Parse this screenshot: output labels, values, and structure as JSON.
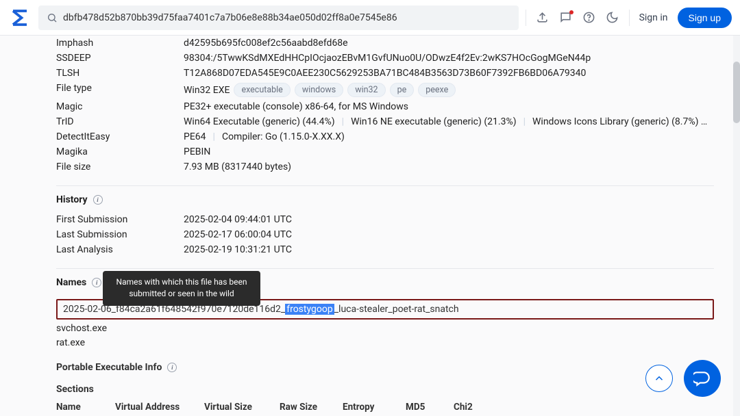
{
  "header": {
    "search_value": "dbfb478d52b870bb39d75faa7401c7a7b06e8e88b34ae050d02ff8a0e7545e86",
    "signin": "Sign in",
    "signup": "Sign up"
  },
  "details": {
    "imphash": {
      "label": "Imphash",
      "value": "d42595b695fc008ef2c56aabd8efd68e"
    },
    "ssdeep": {
      "label": "SSDEEP",
      "value": "98304:/5TwwKSdMXEdHHCpIOcjaozEBvM1GvfUNuo0U/ODwzE4f2Ev:2wKS7HOcGogMGeN44p"
    },
    "tlsh": {
      "label": "TLSH",
      "value": "T12A868D07EDA545E9C0AEE230C5629253BA71BC484B3563D73B60F7392FB6BD06A79340"
    },
    "filetype": {
      "label": "File type",
      "value": "Win32 EXE",
      "tags": [
        "executable",
        "windows",
        "win32",
        "pe",
        "peexe"
      ]
    },
    "magic": {
      "label": "Magic",
      "value": "PE32+ executable (console) x86-64, for MS Windows"
    },
    "trid": {
      "label": "TrID",
      "parts": [
        "Win64 Executable (generic) (44.4%)",
        "Win16 NE executable (generic) (21.3%)",
        "Windows Icons Library (generic) (8.7%) …"
      ]
    },
    "die": {
      "label": "DetectItEasy",
      "parts": [
        "PE64",
        "Compiler: Go (1.15.0-X.XX.X)"
      ]
    },
    "magika": {
      "label": "Magika",
      "value": "PEBIN"
    },
    "filesize": {
      "label": "File size",
      "value": "7.93 MB (8317440 bytes)"
    }
  },
  "history": {
    "title": "History",
    "first_label": "First Submission",
    "first_value": "2025-02-04 09:44:01 UTC",
    "last_label": "Last Submission",
    "last_value": "2025-02-17 06:00:04 UTC",
    "analysis_label": "Last Analysis",
    "analysis_value": "2025-02-19 10:31:21 UTC"
  },
  "names": {
    "title": "Names",
    "tooltip": "Names with which this file has been submitted or seen in the wild",
    "highlighted": {
      "prefix": "2025-02-06_f84ca2a61f648542f970e7120de116d2_",
      "selected": "frostygoop",
      "suffix": "_luca-stealer_poet-rat_snatch"
    },
    "items": [
      "svchost.exe",
      "rat.exe"
    ]
  },
  "pe": {
    "title": "Portable Executable Info",
    "sections_title": "Sections",
    "columns": [
      "Name",
      "Virtual Address",
      "Virtual Size",
      "Raw Size",
      "Entropy",
      "MD5",
      "Chi2"
    ]
  }
}
